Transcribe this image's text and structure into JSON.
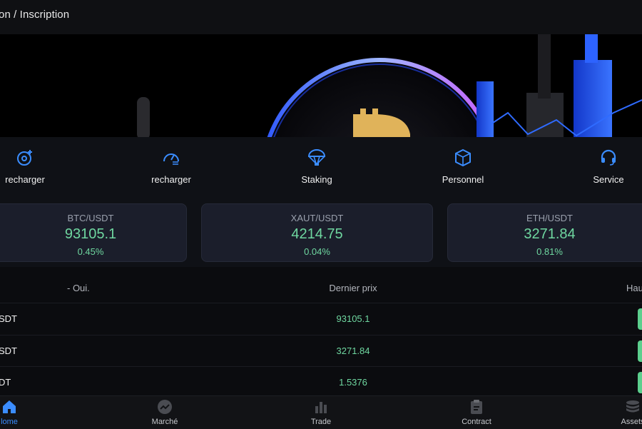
{
  "header": {
    "title": "on / Inscription"
  },
  "shortcuts": [
    {
      "label": "recharger",
      "icon": "deposit-icon"
    },
    {
      "label": "recharger",
      "icon": "speed-icon"
    },
    {
      "label": "Staking",
      "icon": "parachute-icon"
    },
    {
      "label": "Personnel",
      "icon": "cube-icon"
    },
    {
      "label": "Service",
      "icon": "headset-icon"
    }
  ],
  "tickers": [
    {
      "pair": "BTC/USDT",
      "price": "93105.1",
      "change": "0.45%"
    },
    {
      "pair": "XAUT/USDT",
      "price": "4214.75",
      "change": "0.04%"
    },
    {
      "pair": "ETH/USDT",
      "price": "3271.84",
      "change": "0.81%"
    }
  ],
  "table": {
    "headers": {
      "name": "- Oui.",
      "price": "Dernier prix",
      "change": "Hau"
    },
    "rows": [
      {
        "name": "SDT",
        "price": "93105.1"
      },
      {
        "name": "SDT",
        "price": "3271.84"
      },
      {
        "name": "DT",
        "price": "1.5376"
      }
    ]
  },
  "tabbar": [
    {
      "label": "lome",
      "icon": "home-icon",
      "active": true
    },
    {
      "label": "Marché",
      "icon": "market-icon"
    },
    {
      "label": "Trade",
      "icon": "bar-chart-icon"
    },
    {
      "label": "Contract",
      "icon": "clipboard-icon"
    },
    {
      "label": "Assets",
      "icon": "coins-stack-icon"
    }
  ],
  "colors": {
    "accent": "#3b8dff",
    "up": "#6fd7a0",
    "card": "#1b1e2b"
  }
}
